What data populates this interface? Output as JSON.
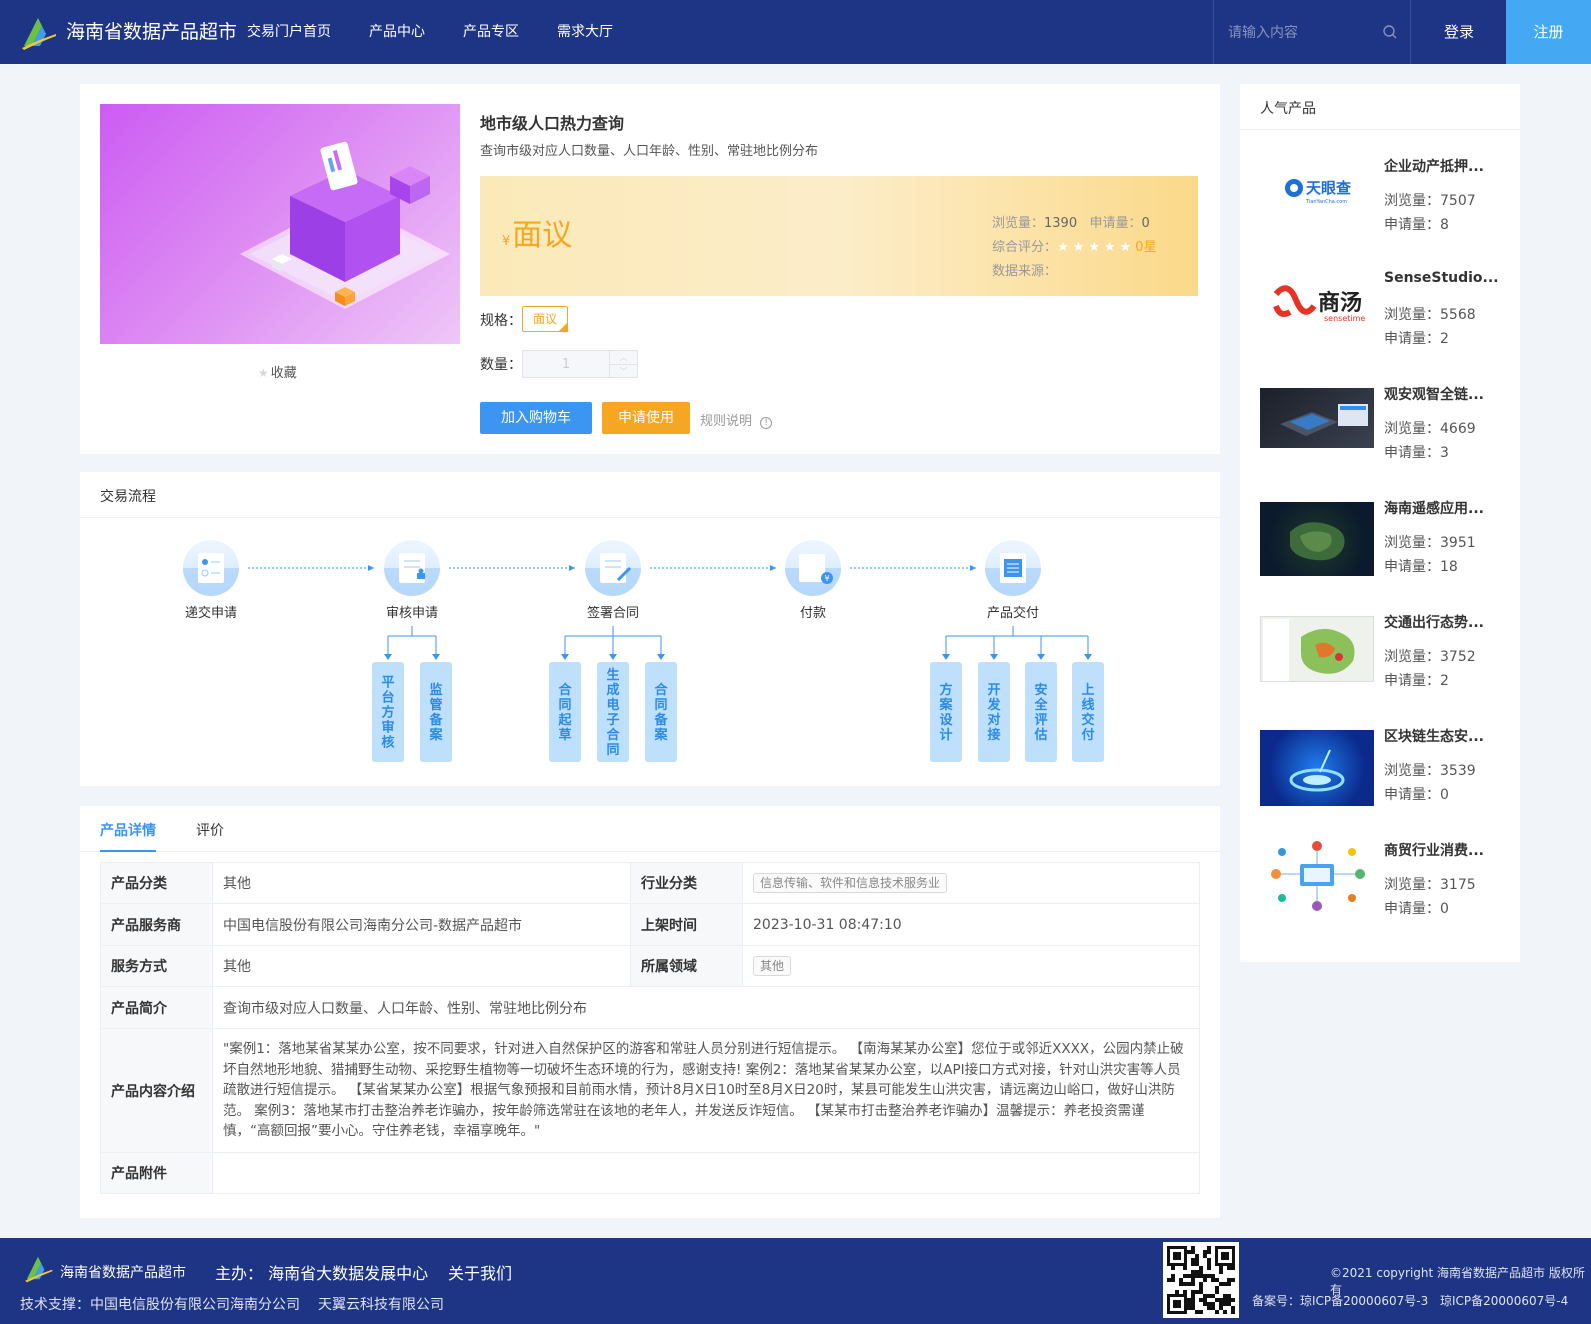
{
  "header": {
    "site_title": "海南省数据产品超市",
    "nav": [
      "交易门户首页",
      "产品中心",
      "产品专区",
      "需求大厅"
    ],
    "search_placeholder": "请输入内容",
    "login": "登录",
    "register": "注册"
  },
  "product": {
    "title": "地市级人口热力查询",
    "subtitle": "查询市级对应人口数量、人口年龄、性别、常驻地比例分布",
    "price_symbol": "¥",
    "price": "面议",
    "views_label": "浏览量：",
    "views": "1390",
    "applies_label": "申请量：",
    "applies": "0",
    "rating_label": "综合评分：",
    "rating": "0星",
    "rating_stars": "★★★★★",
    "source_label": "数据来源：",
    "favorite": "收藏",
    "spec_label": "规格：",
    "spec": "面议",
    "qty_label": "数量：",
    "qty_value": "1",
    "add_cart": "加入购物车",
    "apply": "申请使用",
    "rules": "规则说明"
  },
  "flow": {
    "title": "交易流程",
    "steps": [
      "递交申请",
      "审核申请",
      "签署合同",
      "付款",
      "产品交付"
    ],
    "review_subs": [
      "平台方审核",
      "监管备案"
    ],
    "contract_subs": [
      "合同起草",
      "生成电子合同",
      "合同备案"
    ],
    "delivery_subs": [
      "方案设计",
      "开发对接",
      "安全评估",
      "上线交付"
    ]
  },
  "detail": {
    "tabs": [
      "产品详情",
      "评价"
    ],
    "rows": {
      "category_k": "产品分类",
      "category_v": "其他",
      "industry_k": "行业分类",
      "industry_v": "信息传输、软件和信息技术服务业",
      "provider_k": "产品服务商",
      "provider_v": "中国电信股份有限公司海南分公司-数据产品超市",
      "listed_k": "上架时间",
      "listed_v": "2023-10-31 08:47:10",
      "service_k": "服务方式",
      "service_v": "其他",
      "domain_k": "所属领域",
      "domain_v": "其他",
      "intro_k": "产品简介",
      "intro_v": "查询市级对应人口数量、人口年龄、性别、常驻地比例分布",
      "content_k": "产品内容介绍",
      "content_v": "\"案例1：落地某省某某办公室，按不同要求，针对进入自然保护区的游客和常驻人员分别进行短信提示。 【南海某某办公室】您位于或邻近XXXX，公园内禁止破坏自然地形地貌、猎捕野生动物、采挖野生植物等一切破坏生态环境的行为，感谢支持! 案例2：落地某省某某办公室，以API接口方式对接，针对山洪灾害等人员疏散进行短信提示。 【某省某某办公室】根据气象预报和目前雨水情，预计8月X日10时至8月X日20时，某县可能发生山洪灾害，请远离边山峪口，做好山洪防范。 案例3：落地某市打击整治养老诈骗办，按年龄筛选常驻在该地的老年人，并发送反诈短信。 【某某市打击整治养老诈骗办】温馨提示：养老投资需谨慎，“高额回报”要小心。守住养老钱，幸福享晚年。\"",
      "attach_k": "产品附件",
      "attach_v": ""
    }
  },
  "sidebar": {
    "title": "人气产品",
    "items": [
      {
        "name": "企业动产抵押...",
        "views": "浏览量：7507",
        "applies": "申请量：8",
        "thumb": "tianyancha-logo"
      },
      {
        "name": "SenseStudio...",
        "views": "浏览量：5568",
        "applies": "申请量：2",
        "thumb": "sensetime-logo"
      },
      {
        "name": "观安观智全链...",
        "views": "浏览量：4669",
        "applies": "申请量：3",
        "thumb": "device-image"
      },
      {
        "name": "海南遥感应用...",
        "views": "浏览量：3951",
        "applies": "申请量：18",
        "thumb": "satellite-map"
      },
      {
        "name": "交通出行态势...",
        "views": "浏览量：3752",
        "applies": "申请量：2",
        "thumb": "traffic-map"
      },
      {
        "name": "区块链生态安...",
        "views": "浏览量：3539",
        "applies": "申请量：0",
        "thumb": "blockchain-image"
      },
      {
        "name": "商贸行业消费...",
        "views": "浏览量：3175",
        "applies": "申请量：0",
        "thumb": "network-diagram"
      }
    ],
    "tianyancha_cn": "天眼查",
    "tianyancha_en": "TianYanCha.com",
    "sensetime_cn": "商汤",
    "sensetime_en": "sensetime"
  },
  "footer": {
    "site": "海南省数据产品超市",
    "host": "主办： 海南省大数据发展中心",
    "about": "关于我们",
    "tech": "技术支撑：中国电信股份有限公司海南分公司",
    "tech2": "天翼云科技有限公司",
    "copyright": "©2021 copyright 海南省数据产品超市 版权所有",
    "icp1": "备案号：琼ICP备20000607号-3",
    "icp2": "琼ICP备20000607号-4"
  },
  "colors": {
    "header": "#1e3485",
    "accent_blue": "#3b95f1",
    "accent_orange": "#f5a623",
    "register": "#44a8f2"
  }
}
